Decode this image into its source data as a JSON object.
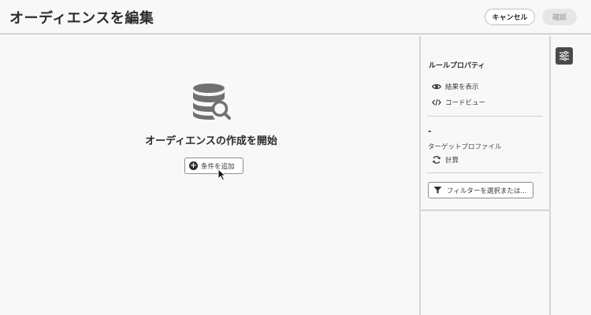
{
  "header": {
    "title": "オーディエンスを編集",
    "cancel_label": "キャンセル",
    "confirm_label": "確認"
  },
  "canvas": {
    "empty_icon": "database-search-icon",
    "empty_title": "オーディエンスの作成を開始",
    "add_condition_label": "条件を追加"
  },
  "properties": {
    "title": "ルールプロパティ",
    "show_results_label": "結果を表示",
    "code_view_label": "コードビュー",
    "profile_value": "-",
    "profile_label": "ターゲットプロファイル",
    "calculate_label": "計算",
    "filter_label": "フィルターを選択または..."
  },
  "colors": {
    "background": "#f8f8f8",
    "settings_button": "#4a4a4a",
    "confirm_disabled_bg": "#e6e6e6",
    "confirm_disabled_text": "#b1b1b1"
  }
}
